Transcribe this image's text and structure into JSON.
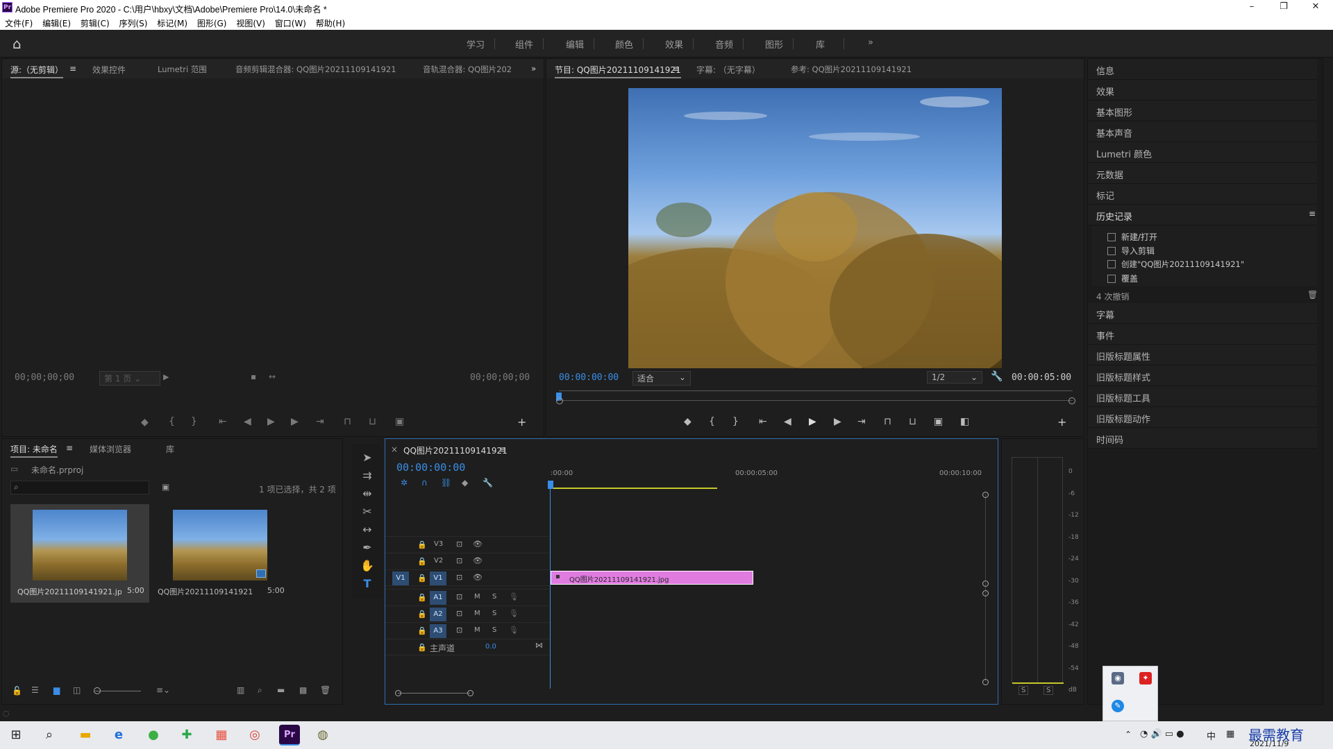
{
  "window": {
    "title": "Adobe Premiere Pro 2020 - C:\\用户\\hbxy\\文档\\Adobe\\Premiere Pro\\14.0\\未命名 *",
    "minimize": "–",
    "maximize": "❐",
    "close": "✕",
    "app_icon_text": "Pr"
  },
  "menu": [
    "文件(F)",
    "编辑(E)",
    "剪辑(C)",
    "序列(S)",
    "标记(M)",
    "图形(G)",
    "视图(V)",
    "窗口(W)",
    "帮助(H)"
  ],
  "workspaces": [
    "学习",
    "组件",
    "编辑",
    "颜色",
    "效果",
    "音频",
    "图形",
    "库"
  ],
  "workspace_more": "»",
  "source_panel": {
    "tabs": [
      "源:（无剪辑）",
      "效果控件",
      "Lumetri 范围",
      "音频剪辑混合器: QQ图片20211109141921",
      "音轨混合器: QQ图片202"
    ],
    "tc_left": "00;00;00;00",
    "page_dropdown": "第 1 页",
    "tc_right": "00;00;00;00"
  },
  "program_panel": {
    "tabs": [
      "节目: QQ图片20211109141921",
      "字幕: （无字幕）",
      "参考: QQ图片20211109141921"
    ],
    "tc_current": "00:00:00:00",
    "fit_dropdown": "适合",
    "res_dropdown": "1/2",
    "tc_duration": "00:00:05:00"
  },
  "right_panels": {
    "items_top": [
      "信息",
      "效果",
      "基本图形",
      "基本声音",
      "Lumetri 颜色",
      "元数据",
      "标记"
    ],
    "history_title": "历史记录",
    "history_items": [
      "新建/打开",
      "导入剪辑",
      "创建\"QQ图片20211109141921\"",
      "覆盖"
    ],
    "undo_count": "4 次撤销",
    "items_bottom": [
      "字幕",
      "事件",
      "旧版标题属性",
      "旧版标题样式",
      "旧版标题工具",
      "旧版标题动作",
      "时间码"
    ]
  },
  "project_panel": {
    "tabs": [
      "项目: 未命名",
      "媒体浏览器",
      "库"
    ],
    "project_file": "未命名.prproj",
    "search_placeholder": "",
    "selection_info": "1 项已选择，共 2 项",
    "items": [
      {
        "name": "QQ图片20211109141921.jpg",
        "duration": "5:00"
      },
      {
        "name": "QQ图片20211109141921",
        "duration": "5:00"
      }
    ]
  },
  "timeline": {
    "sequence_tab": "QQ图片20211109141921",
    "close": "×",
    "timecode": "00:00:00:00",
    "ruler": [
      ":00:00",
      "00:00:05:00",
      "00:00:10:00"
    ],
    "video_tracks": [
      "V3",
      "V2",
      "V1"
    ],
    "source_patch": "V1",
    "audio_tracks": [
      "A1",
      "A2",
      "A3"
    ],
    "mute": "M",
    "solo": "S",
    "master_label": "主声道",
    "master_value": "0.0",
    "clip_name": "QQ图片20211109141921.jpg"
  },
  "audio_meter": {
    "scale": [
      "0",
      "-6",
      "-12",
      "-18",
      "-24",
      "-30",
      "-36",
      "-42",
      "-48",
      "-54",
      "dB"
    ],
    "solo_buttons": [
      "S",
      "S"
    ]
  },
  "taskbar": {
    "tray": "中",
    "date": "2021/11/9",
    "watermark": "最需教育"
  },
  "colors": {
    "accent": "#3a8ee6",
    "clip": "#e07be0",
    "panel": "#1e1e1e",
    "track_label": "#2d4d73"
  }
}
